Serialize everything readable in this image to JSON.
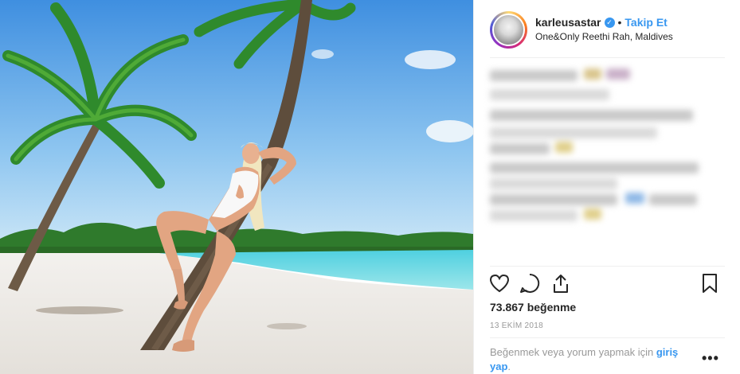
{
  "header": {
    "username": "karleusastar",
    "separator": "•",
    "follow_label": "Takip Et",
    "location": "One&Only Reethi Rah, Maldives",
    "avatar_icon": "profile-avatar-icon",
    "verified_icon": "verified-badge-icon"
  },
  "caption": {
    "state": "blurred"
  },
  "actions": {
    "like_icon": "heart-icon",
    "comment_icon": "comment-icon",
    "share_icon": "share-icon",
    "save_icon": "bookmark-icon"
  },
  "likes": "73.867 beğenme",
  "date": "13 EKİM 2018",
  "login_prompt": {
    "text": "Beğenmek veya yorum yapmak için",
    "link": "giriş yap",
    "period": "."
  },
  "more_label": "•••",
  "colors": {
    "accent": "#3897f0",
    "text": "#262626",
    "muted": "#999999",
    "divider": "#efefef"
  }
}
